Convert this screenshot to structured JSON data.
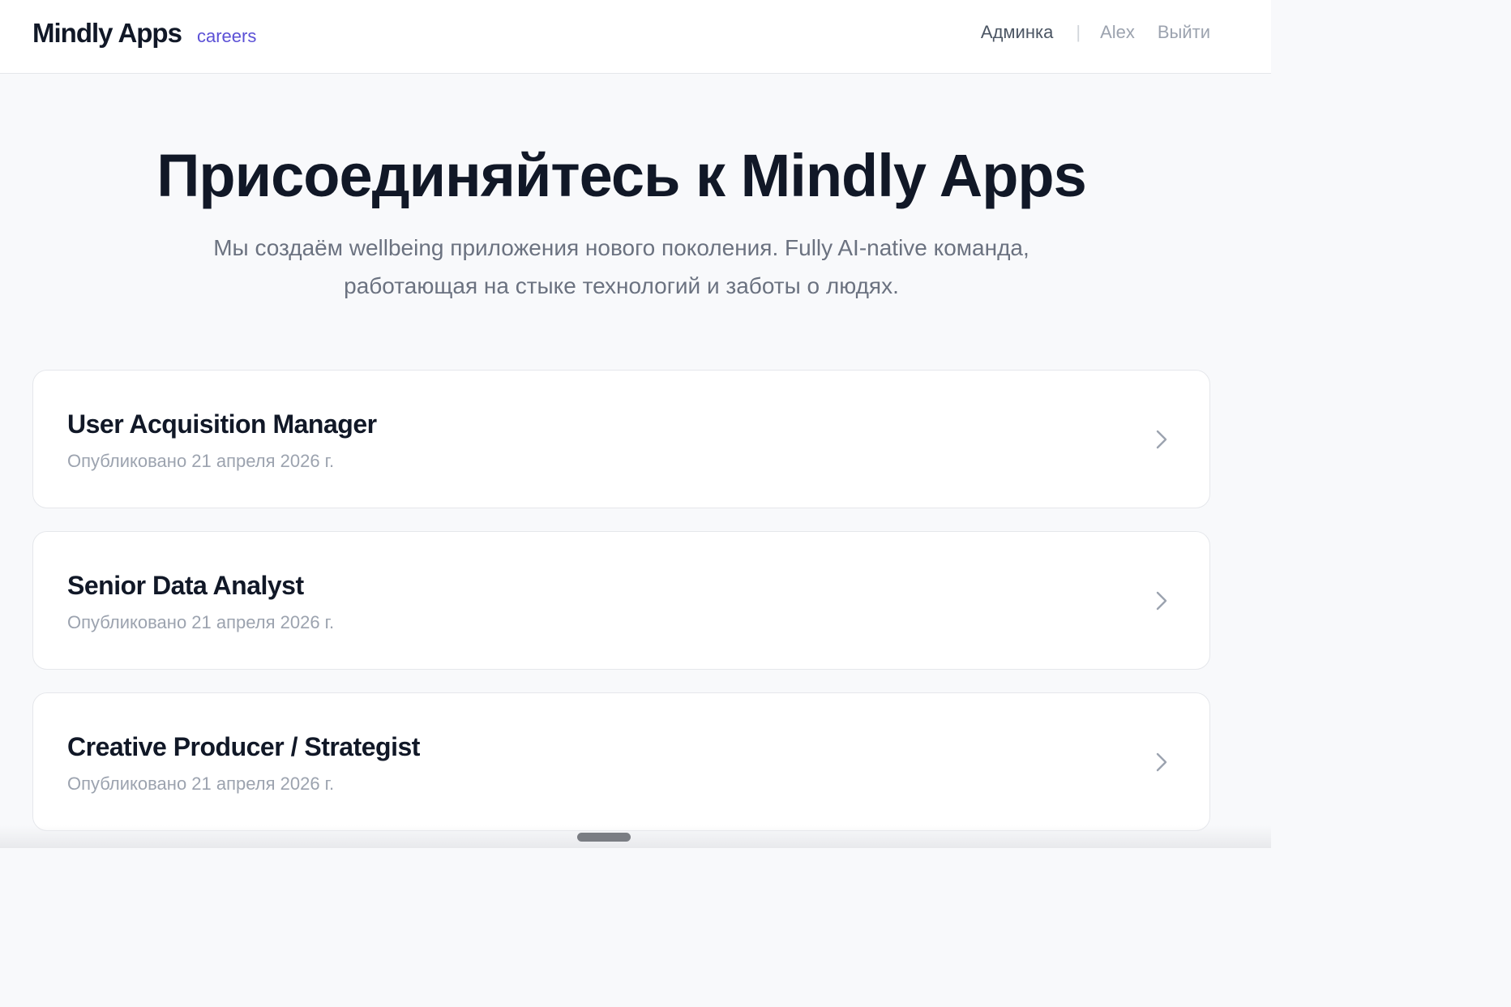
{
  "header": {
    "brand": "Mindly Apps",
    "brand_sub": "careers",
    "nav": {
      "admin": "Админка",
      "separator": "|",
      "user": "Alex",
      "logout": "Выйти"
    }
  },
  "hero": {
    "title": "Присоединяйтесь к Mindly Apps",
    "description_lines": [
      "Мы создаём wellbeing приложения нового поколения. Fully AI-native команда,",
      "работающая на стыке технологий и заботы о людях."
    ]
  },
  "jobs": [
    {
      "title": "User Acquisition Manager",
      "date": "Опубликовано 21 апреля 2026 г."
    },
    {
      "title": "Senior Data Analyst",
      "date": "Опубликовано 21 апреля 2026 г."
    },
    {
      "title": "Creative Producer / Strategist",
      "date": "Опубликовано 21 апреля 2026 г."
    }
  ],
  "icons": {
    "job_arrow": "chevron-right-icon"
  },
  "colors": {
    "accent": "#5b50d6",
    "page_bg": "#f8f9fb",
    "card_bg": "#ffffff",
    "text_primary": "#111827",
    "text_muted": "#9ca3af"
  }
}
